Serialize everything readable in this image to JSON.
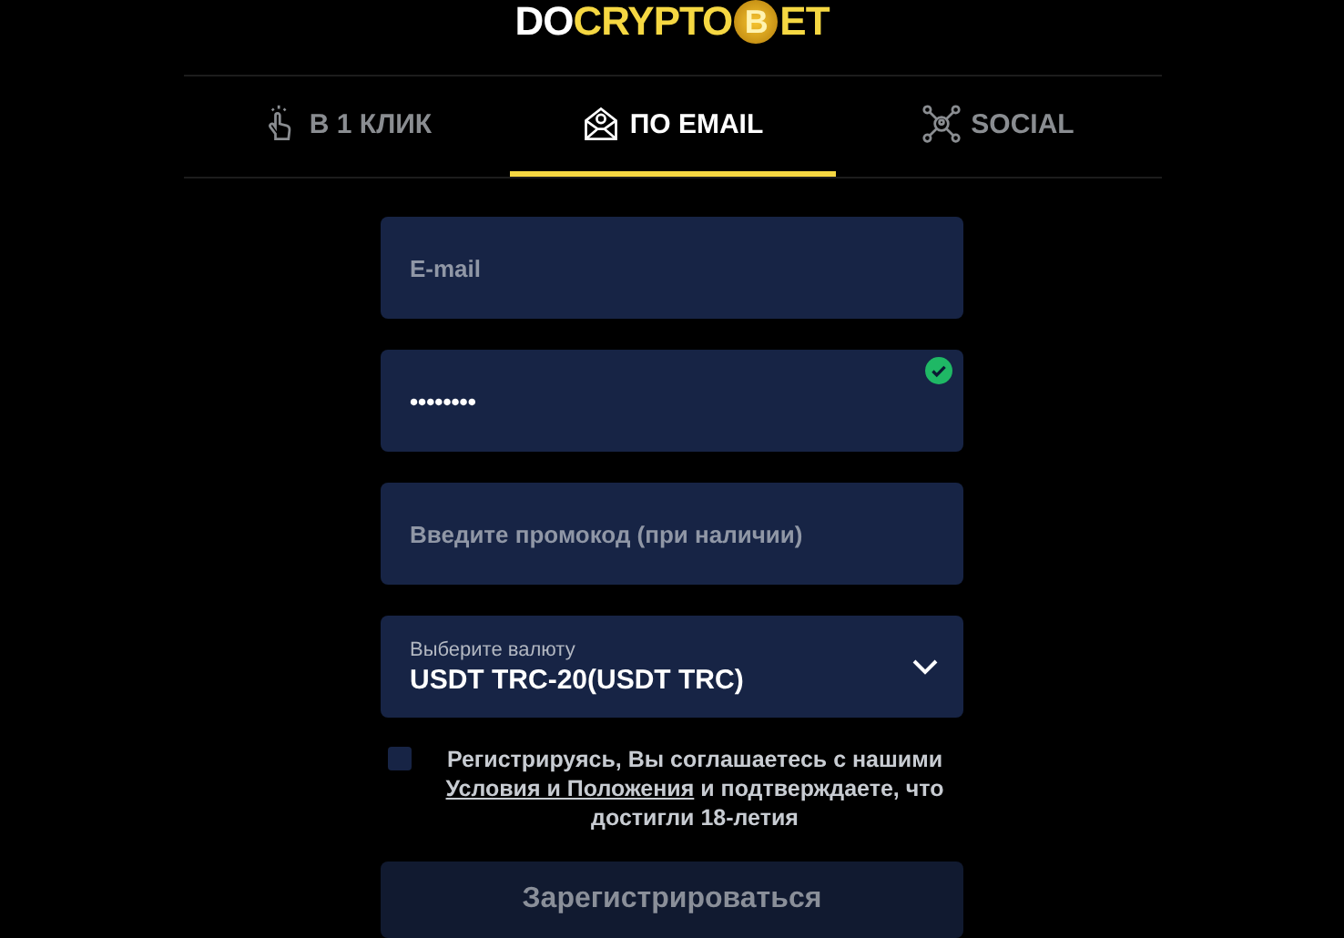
{
  "logo": {
    "parts": [
      {
        "kind": "plain",
        "text": "DO"
      },
      {
        "kind": "accent",
        "text": "CRYPTO"
      },
      {
        "kind": "coin",
        "text": "B"
      },
      {
        "kind": "accent",
        "text": "ET"
      }
    ]
  },
  "tabs": [
    {
      "kind": "click",
      "label": "В 1 КЛИК",
      "selected": false
    },
    {
      "kind": "email",
      "label": "ПО EMAIL",
      "selected": true
    },
    {
      "kind": "social",
      "label": "SOCIAL",
      "selected": false
    }
  ],
  "fields": [
    {
      "kind": "text",
      "placeholder": "E-mail"
    },
    {
      "kind": "password",
      "value": "••••••••",
      "valid": true
    },
    {
      "kind": "text",
      "placeholder": "Введите промокод (при наличии)"
    },
    {
      "kind": "select",
      "label": "Выберите валюту",
      "value": "USDT TRC-20(USDT TRC)"
    }
  ],
  "agreement": {
    "checked": false,
    "before": "Регистрируясь, Вы соглашаетесь с нашими",
    "link": "Условия и Положения",
    "after": "и подтверждаете, что достигли 18-летия"
  },
  "submit": {
    "label": "Зарегистрироваться",
    "disabled": true
  }
}
